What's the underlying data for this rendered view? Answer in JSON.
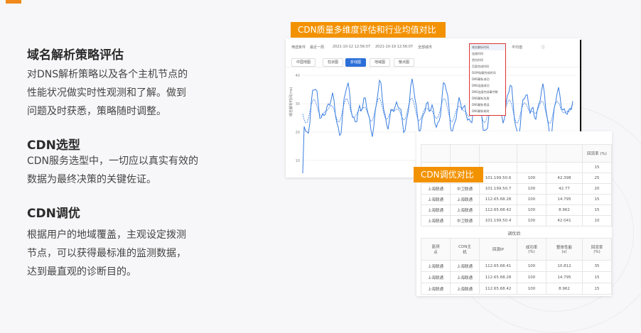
{
  "sections": [
    {
      "title": "域名解析策略评估",
      "text": "对DNS解析策略以及各个主机节点的\n性能状况做实时性观测和了解。做到\n问题及时获悉，策略随时调整。"
    },
    {
      "title": "CDN选型",
      "text": "CDN服务选型中，一切应以真实有效的\n数据为最终决策的关键佐证。"
    },
    {
      "title": "CDN调优",
      "text": "根据用户的地域覆盖，主观设定拨测\n节点，可以获得最标准的监测数据，\n达到最直观的诊断目的。"
    }
  ],
  "chart_panel": {
    "label": "CDN质量多维度评估和行业均值对比",
    "filters": [
      "筛选条件",
      "最近一周",
      "2021-10-12 12:56:07",
      "2021-10-19 12:56:07",
      "全部城市",
      "域名解析时间",
      "平均值"
    ],
    "tabs": [
      "中国地图",
      "柱状图",
      "折线图",
      "地域图",
      "散点图"
    ],
    "active_tab": "折线图",
    "dropdown_items": [
      "域名解析时间",
      "连接时间",
      "首包时间",
      "页面完成时间",
      "DOM加载完成时间",
      "DNS解析成功",
      "DNS连接成功",
      "DNS连接完成事件数",
      "DNS解析失败",
      "DNS解析错误",
      "DNS解析耗时"
    ],
    "y_label": "域名解析时间(ms)",
    "y_ticks": [
      "40",
      "30",
      "20",
      "10"
    ],
    "line_color": "#3a7ee0"
  },
  "table_card": {
    "label": "CDN调优对比",
    "top_table": {
      "header_partial": [
        "",
        "",
        "",
        "",
        "",
        "回流率\n(%)"
      ],
      "rows": [
        [
          "",
          "",
          "",
          "",
          "",
          "15"
        ],
        [
          "上海联通",
          "中卫联通",
          "101.199.50.6",
          "100",
          "42.398",
          "25"
        ],
        [
          "上海联通",
          "中卫联通",
          "101.199.50.7",
          "100",
          "42.77",
          "20"
        ],
        [
          "上海联通",
          "上海联通",
          "112.65.68.28",
          "100",
          "14.795",
          "15"
        ],
        [
          "上海联通",
          "上海联通",
          "112.65.68.42",
          "100",
          "8.962",
          "15"
        ],
        [
          "上海联通",
          "中卫联通",
          "101.199.50.4",
          "100",
          "42.041",
          "10"
        ]
      ]
    },
    "mid_title": "调优后",
    "bottom_table": {
      "headers": [
        "监测\n点",
        "CDN主\n机",
        "回源IP",
        "成功率\n(%)",
        "整体性能\n(s)",
        "回流率\n(%)"
      ],
      "rows": [
        [
          "上海联通",
          "上海联通",
          "112.65.68.41",
          "100",
          "10.812",
          "35"
        ],
        [
          "上海联通",
          "上海联通",
          "112.65.68.28",
          "100",
          "14.795",
          "15"
        ],
        [
          "上海联通",
          "上海联通",
          "112.65.68.42",
          "100",
          "8.962",
          "15"
        ]
      ]
    }
  }
}
